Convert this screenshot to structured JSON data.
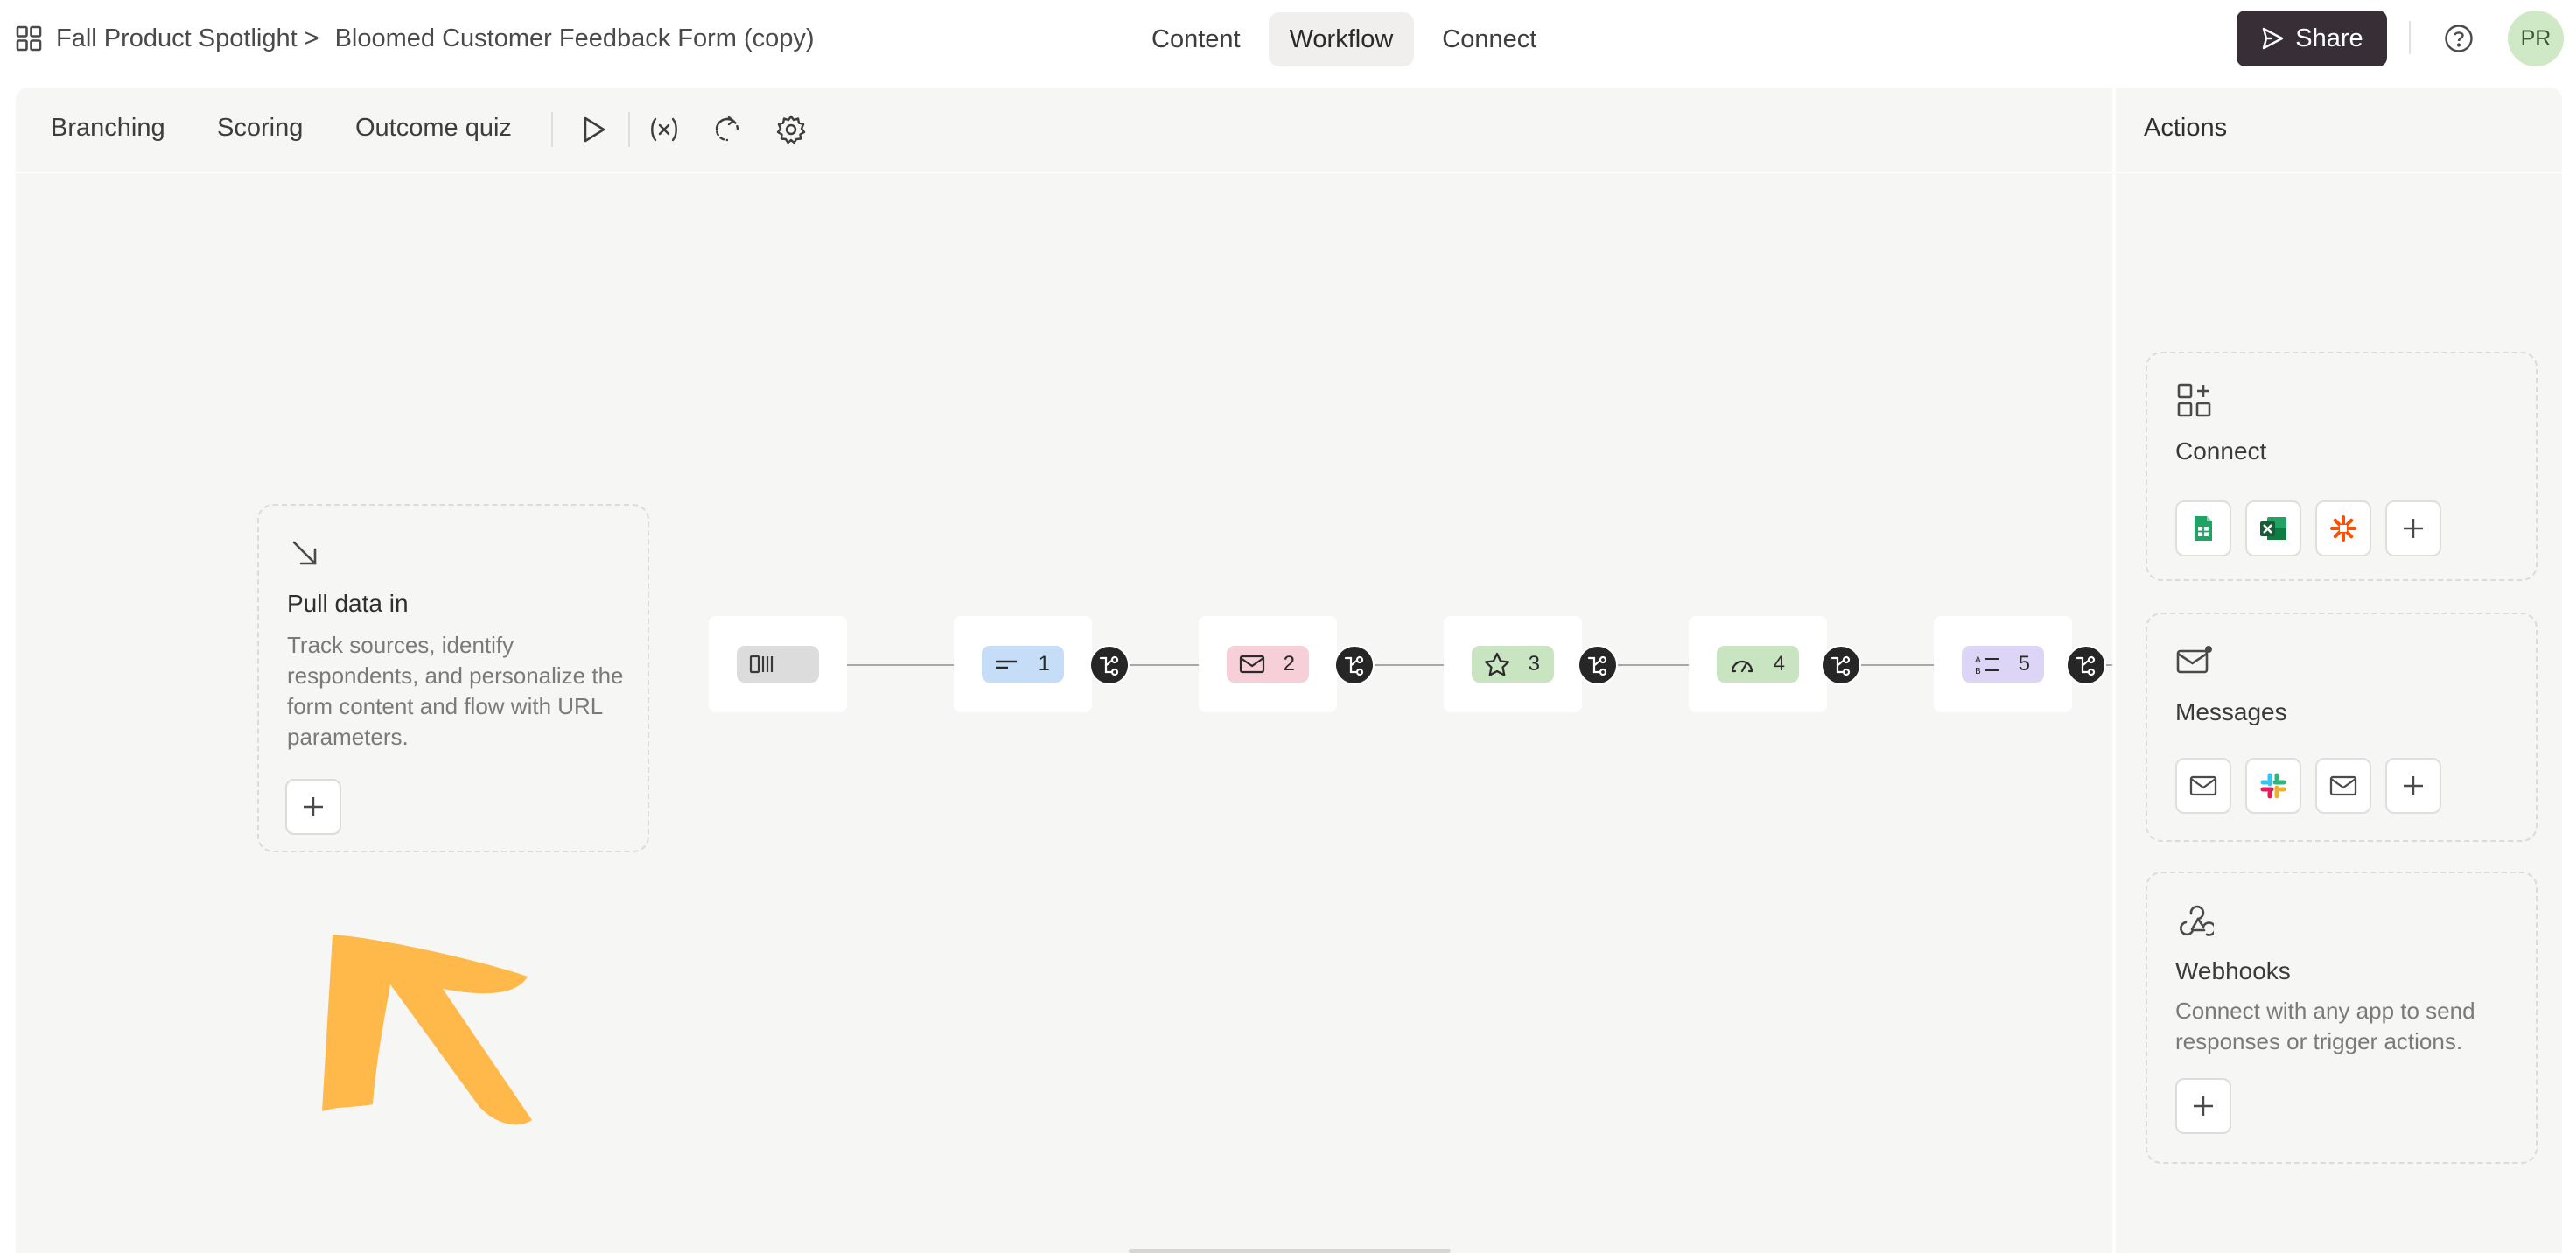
{
  "breadcrumb": {
    "workspace": "Fall Product Spotlight",
    "separator": ">",
    "form_title": "Bloomed Customer Feedback Form (copy)"
  },
  "tabs": [
    "Content",
    "Workflow",
    "Connect"
  ],
  "active_tab": "Workflow",
  "header": {
    "share_label": "Share",
    "avatar_initials": "PR"
  },
  "toolbar": {
    "tabs": [
      "Branching",
      "Scoring",
      "Outcome quiz"
    ],
    "icons": [
      "play-icon",
      "variables-icon",
      "redirect-icon",
      "settings-icon"
    ]
  },
  "pull_data": {
    "title": "Pull data in",
    "description": "Track sources, identify respondents, and personalize the form content and flow with URL parameters."
  },
  "flow": {
    "nodes": [
      {
        "icon": "welcome-screen-icon",
        "number": "",
        "color": "#dcdcdc"
      },
      {
        "icon": "short-text-icon",
        "number": "1",
        "color": "#c5ddf6"
      },
      {
        "icon": "email-icon",
        "number": "2",
        "color": "#f7cfd9"
      },
      {
        "icon": "star-rating-icon",
        "number": "3",
        "color": "#c8e4c0"
      },
      {
        "icon": "opinion-scale-icon",
        "number": "4",
        "color": "#c8e4c0"
      },
      {
        "icon": "multiple-choice-icon",
        "number": "5",
        "color": "#ddd5f5"
      }
    ]
  },
  "actions": {
    "title": "Actions",
    "connect": {
      "title": "Connect",
      "integrations": [
        "google-sheets-icon",
        "excel-icon",
        "zapier-icon"
      ]
    },
    "messages": {
      "title": "Messages",
      "integrations": [
        "email-icon",
        "slack-icon",
        "email-icon"
      ]
    },
    "webhooks": {
      "title": "Webhooks",
      "description": "Connect with any app to send responses or trigger actions."
    }
  },
  "colors": {
    "accent_dark": "#372f35",
    "annotation_arrow": "#ffb84a",
    "canvas_bg": "#f6f6f5"
  }
}
